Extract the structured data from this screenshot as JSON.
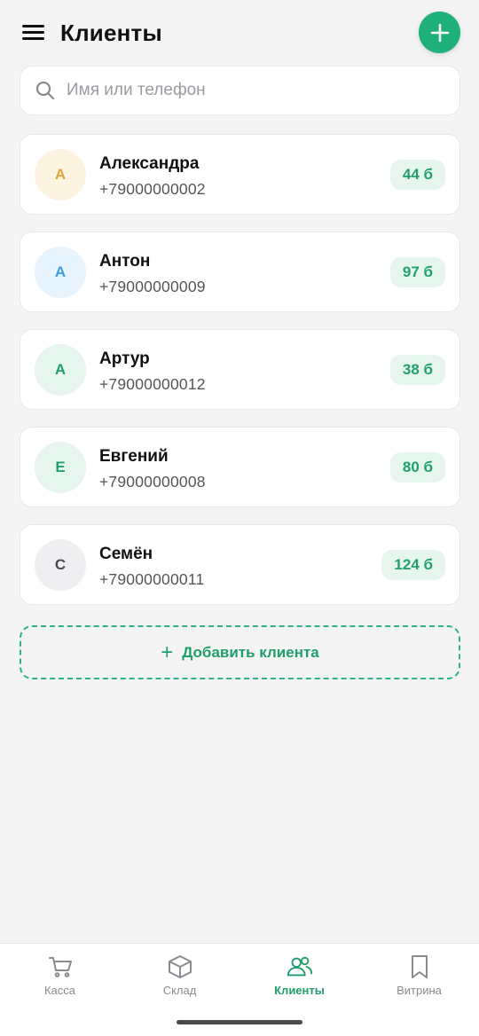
{
  "header": {
    "title": "Клиенты",
    "menu_icon": "hamburger-menu-icon",
    "add_icon": "plus-icon"
  },
  "search": {
    "placeholder": "Имя или телефон",
    "value": ""
  },
  "clients": [
    {
      "initial": "А",
      "name": "Александра",
      "phone": "+79000000002",
      "points": "44 б",
      "avatar_bg": "#fdf3e1",
      "avatar_fg": "#e0a33a"
    },
    {
      "initial": "А",
      "name": "Антон",
      "phone": "+79000000009",
      "points": "97 б",
      "avatar_bg": "#e7f3fd",
      "avatar_fg": "#3aa0e0"
    },
    {
      "initial": "А",
      "name": "Артур",
      "phone": "+79000000012",
      "points": "38 б",
      "avatar_bg": "#e6f6ef",
      "avatar_fg": "#1fa06e"
    },
    {
      "initial": "Е",
      "name": "Евгений",
      "phone": "+79000000008",
      "points": "80 б",
      "avatar_bg": "#e6f6ef",
      "avatar_fg": "#1fa06e"
    },
    {
      "initial": "С",
      "name": "Семён",
      "phone": "+79000000011",
      "points": "124 б",
      "avatar_bg": "#efeff1",
      "avatar_fg": "#4a4a4f"
    }
  ],
  "add_client": {
    "plus": "+",
    "label": "Добавить клиента"
  },
  "nav": {
    "items": [
      {
        "label": "Касса",
        "icon": "cart-icon",
        "active": false
      },
      {
        "label": "Склад",
        "icon": "box-icon",
        "active": false
      },
      {
        "label": "Клиенты",
        "icon": "users-icon",
        "active": true
      },
      {
        "label": "Витрина",
        "icon": "bookmark-icon",
        "active": false
      }
    ]
  },
  "colors": {
    "accent": "#20b07a",
    "background": "#f4f4f5"
  }
}
